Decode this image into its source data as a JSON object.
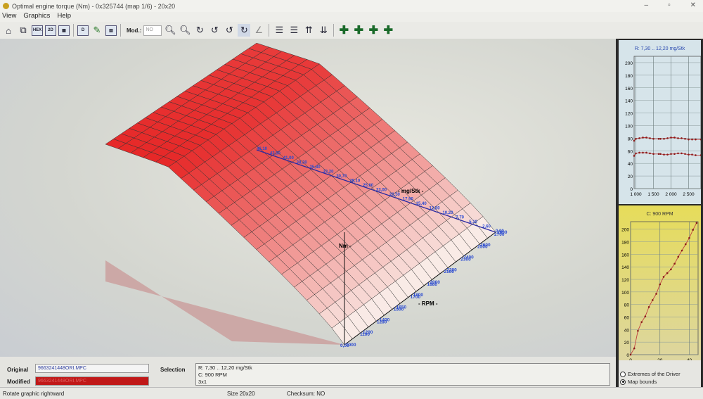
{
  "window": {
    "title": "Optimal engine torque (Nm) - 0x325744 (map 1/6) - 20x20",
    "minimize": "–",
    "maximize": "▫",
    "close": "✕"
  },
  "menu": [
    "View",
    "Graphics",
    "Help"
  ],
  "toolbar": {
    "mod_label": "Mod.:",
    "mod_value": "NO",
    "hex": "HEX",
    "two_d": "2D",
    "d": "D"
  },
  "graph3d": {
    "load_axis_label": "- mg/Stk -",
    "rpm_axis_label": "- RPM -",
    "torque_axis_label": "Nm -",
    "rpm_ticks": [
      "1000",
      "1100",
      "1200",
      "1280",
      "1400",
      "1500",
      "1650",
      "1700",
      "1800",
      "1880",
      "2000",
      "2100",
      "2200",
      "2300",
      "2400",
      "2500",
      "2600",
      "2700",
      "2800"
    ],
    "load_ticks": [
      "46,10",
      "43,50",
      "41,00",
      "38,30",
      "35,80",
      "33,20",
      "30,70",
      "28,10",
      "25,60",
      "23,00",
      "20,50",
      "17,90",
      "15,40",
      "12,80",
      "10,20",
      "7,70",
      "5,10",
      "2,60",
      "0,00"
    ],
    "origin_label": "0,00"
  },
  "bottom": {
    "original_label": "Original",
    "original_file": "9663241448ORI.MPC",
    "modified_label": "Modified",
    "modified_file": "9663241448ORI.MPC",
    "selection_label": "Selection",
    "selection_lines": [
      "R: 7,30 .. 12,20 mg/Stk",
      "C: 900 RPM",
      "3x1"
    ]
  },
  "status": {
    "hint": "Rotate graphic rightward",
    "size": "Size 20x20",
    "checksum": "Checksum: NO"
  },
  "side": {
    "radio_extremes": "Extremes of the Driver",
    "radio_bounds": "Map bounds",
    "selected": "Map bounds"
  },
  "chart_data": [
    {
      "type": "line",
      "title": "R: 7,30 .. 12,20 mg/Stk",
      "xlim": [
        950,
        2850
      ],
      "ylim": [
        0,
        210
      ],
      "xticks": [
        "1 000",
        "1 500",
        "2 000",
        "2 500"
      ],
      "yticks": [
        "0",
        "20",
        "40",
        "60",
        "80",
        "100",
        "120",
        "140",
        "160",
        "180",
        "200"
      ],
      "x": [
        950,
        1000,
        1100,
        1200,
        1300,
        1400,
        1500,
        1650,
        1700,
        1800,
        1900,
        2000,
        2100,
        2200,
        2300,
        2400,
        2500,
        2600,
        2700,
        2850
      ],
      "series": [
        {
          "name": "upper",
          "values": [
            76,
            79,
            80,
            81,
            81,
            80,
            79,
            79,
            79,
            79,
            80,
            81,
            81,
            80,
            80,
            79,
            78,
            78,
            78,
            78
          ]
        },
        {
          "name": "lower",
          "values": [
            52,
            56,
            57,
            57,
            57,
            56,
            55,
            55,
            55,
            54,
            54,
            55,
            55,
            56,
            56,
            55,
            54,
            54,
            53,
            53
          ]
        }
      ],
      "color": "#8a1a1a"
    },
    {
      "type": "line",
      "title": "C: 900 RPM",
      "xlim": [
        0,
        46
      ],
      "ylim": [
        0,
        212
      ],
      "xticks": [
        "0",
        "20",
        "40"
      ],
      "yticks": [
        "0",
        "20",
        "40",
        "60",
        "80",
        "100",
        "120",
        "140",
        "160",
        "180",
        "200"
      ],
      "x": [
        0,
        2.5,
        5,
        7.5,
        10,
        12.5,
        15,
        17.5,
        20,
        22.5,
        25,
        27.5,
        30,
        32.5,
        35,
        37.5,
        40,
        42.5,
        45
      ],
      "series": [
        {
          "name": "torque",
          "values": [
            0,
            10,
            38,
            52,
            61,
            76,
            87,
            97,
            112,
            124,
            130,
            136,
            145,
            156,
            166,
            176,
            186,
            199,
            210
          ]
        }
      ],
      "color": "#8a1a1a"
    }
  ]
}
